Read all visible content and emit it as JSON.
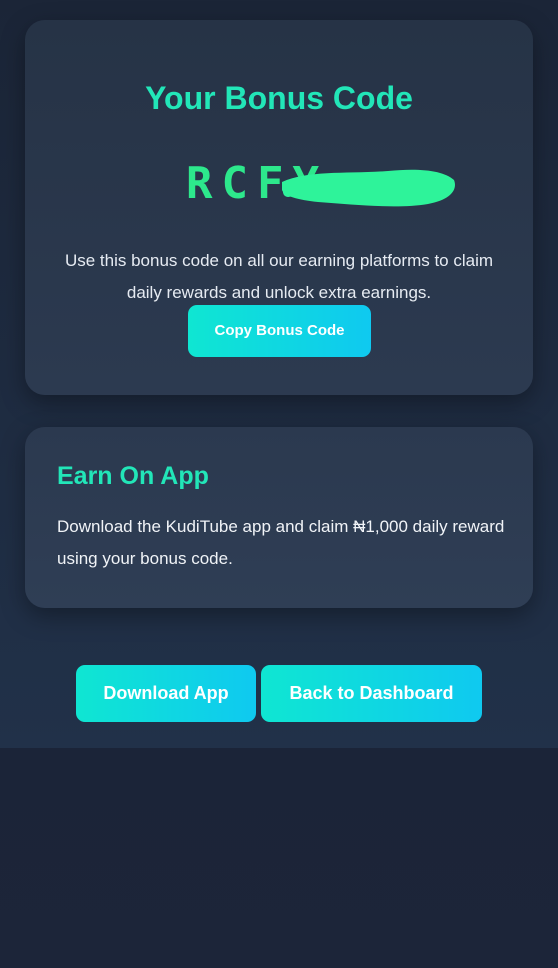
{
  "bonus_card": {
    "title": "Your Bonus Code",
    "code_visible": "RCFY",
    "description": "Use this bonus code on all our earning platforms to claim daily rewards and unlock extra earnings.",
    "copy_button_label": "Copy Bonus Code"
  },
  "app_card": {
    "title": "Earn On App",
    "description": "Download the KudiTube app and claim ₦1,000 daily reward using your bonus code."
  },
  "actions": {
    "download_label": "Download App",
    "dashboard_label": "Back to Dashboard"
  },
  "colors": {
    "accent_teal": "#22e6b8",
    "code_green": "#2de88c",
    "button_gradient_start": "#0fe6d2",
    "button_gradient_end": "#0fc9f0",
    "card_bg": "#283548",
    "page_bg": "#1b2537"
  }
}
